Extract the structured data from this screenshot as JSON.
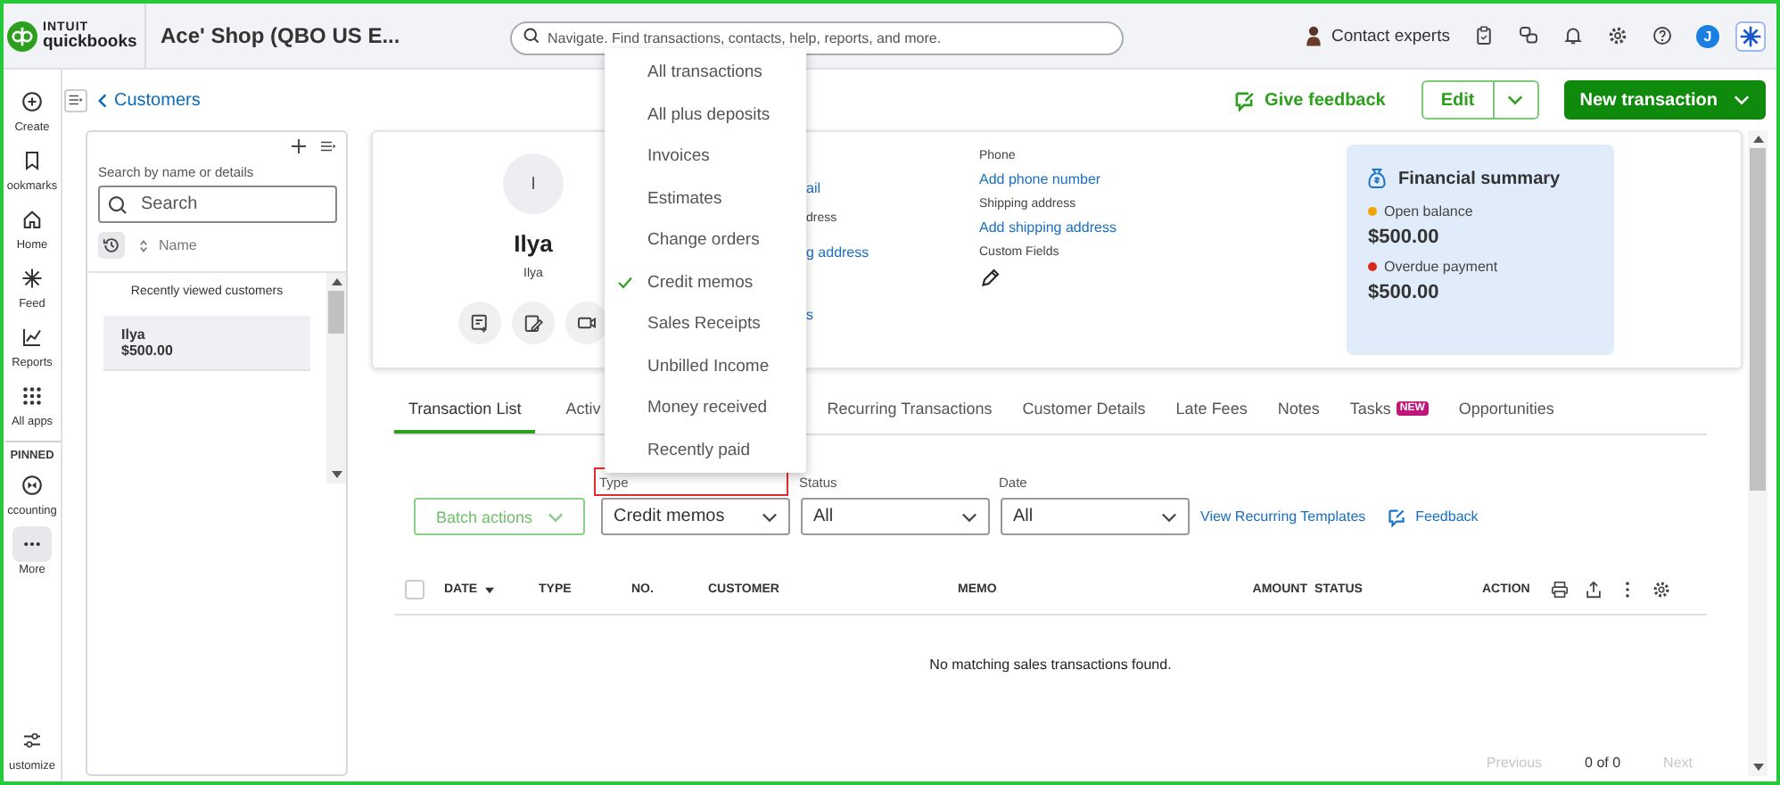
{
  "app": {
    "logo_brand": "INTUIT",
    "logo_product": "quickbooks",
    "company": "Ace' Shop (QBO US E...",
    "search_placeholder": "Navigate. Find transactions, contacts, help, reports, and more.",
    "contact_label": "Contact experts",
    "user_initial": "J"
  },
  "nav": {
    "items": [
      {
        "label": "Create",
        "kind": "create",
        "selected": false
      },
      {
        "label": "ookmarks",
        "kind": "bookmark",
        "selected": false
      },
      {
        "label": "Home",
        "kind": "home",
        "selected": false
      },
      {
        "label": "Feed",
        "kind": "feed",
        "selected": false
      },
      {
        "label": "Reports",
        "kind": "reports",
        "selected": false
      },
      {
        "label": "All apps",
        "kind": "apps",
        "selected": false
      }
    ],
    "pinned_heading": "PINNED",
    "pinned": [
      {
        "label": "ccounting",
        "kind": "accounting",
        "selected": false
      },
      {
        "label": "More",
        "kind": "more",
        "selected": true
      }
    ],
    "bottom": {
      "label": "ustomize",
      "kind": "customize",
      "selected": false
    }
  },
  "breadcrumb": "Customers",
  "header_actions": {
    "feedback": "Give feedback",
    "edit": "Edit",
    "new_transaction": "New transaction"
  },
  "customer_list": {
    "search_label": "Search by name or details",
    "search_placeholder": "Search",
    "sort_label": "Name",
    "recent_heading": "Recently viewed customers",
    "items": [
      {
        "name": "Ilya",
        "balance": "$500.00",
        "selected": true
      }
    ]
  },
  "customer": {
    "initial": "I",
    "name": "Ilya",
    "subtitle": "Ilya",
    "contact_fragments": [
      {
        "kind": "link",
        "text": "ail"
      },
      {
        "kind": "label",
        "text": "dress"
      },
      {
        "kind": "link",
        "text": "g address"
      },
      {
        "kind": "link",
        "text": "s"
      }
    ],
    "details": [
      {
        "kind": "link",
        "label": "Phone",
        "value": "Add phone number"
      },
      {
        "kind": "link",
        "label": "Shipping address",
        "value": "Add shipping address"
      },
      {
        "kind": "edit",
        "label": "Custom Fields"
      }
    ]
  },
  "financial_summary": {
    "title": "Financial summary",
    "items": [
      {
        "label": "Open balance",
        "amount": "$500.00",
        "color": "#f5a300"
      },
      {
        "label": "Overdue payment",
        "amount": "$500.00",
        "color": "#d52b1e"
      }
    ]
  },
  "tabs": [
    {
      "label": "Transaction List",
      "selected": true
    },
    {
      "label": "Activ",
      "selected": false
    },
    {
      "label": "Recurring Transactions",
      "selected": false
    },
    {
      "label": "Customer Details",
      "selected": false
    },
    {
      "label": "Late Fees",
      "selected": false
    },
    {
      "label": "Notes",
      "selected": false
    },
    {
      "label": "Tasks",
      "badge": "NEW",
      "selected": false
    },
    {
      "label": "Opportunities",
      "selected": false
    }
  ],
  "filters": {
    "batch": "Batch actions",
    "selects": [
      {
        "label": "Type",
        "value": "Credit memos",
        "highlighted": true
      },
      {
        "label": "Status",
        "value": "All",
        "highlighted": false
      },
      {
        "label": "Date",
        "value": "All",
        "highlighted": false
      }
    ],
    "recurring_link": "View Recurring Templates",
    "feedback": "Feedback"
  },
  "table": {
    "select_all_checked": false,
    "columns": [
      {
        "label": "DATE",
        "sorted": true
      },
      {
        "label": "TYPE",
        "sorted": false
      },
      {
        "label": "NO.",
        "sorted": false
      },
      {
        "label": "CUSTOMER",
        "sorted": false
      },
      {
        "label": "MEMO",
        "sorted": false
      },
      {
        "label": "AMOUNT",
        "sorted": false
      },
      {
        "label": "STATUS",
        "sorted": false
      },
      {
        "label": "ACTION",
        "sorted": false
      }
    ],
    "empty_message": "No matching sales transactions found.",
    "pagination": {
      "previous": "Previous",
      "count": "0 of 0",
      "next": "Next"
    }
  },
  "type_menu": {
    "options": [
      {
        "label": "All transactions",
        "selected": false
      },
      {
        "label": "All plus deposits",
        "selected": false
      },
      {
        "label": "Invoices",
        "selected": false
      },
      {
        "label": "Estimates",
        "selected": false
      },
      {
        "label": "Change orders",
        "selected": false
      },
      {
        "label": "Credit memos",
        "selected": true
      },
      {
        "label": "Sales Receipts",
        "selected": false
      },
      {
        "label": "Unbilled Income",
        "selected": false
      },
      {
        "label": "Money received",
        "selected": false
      },
      {
        "label": "Recently paid",
        "selected": false
      }
    ]
  }
}
